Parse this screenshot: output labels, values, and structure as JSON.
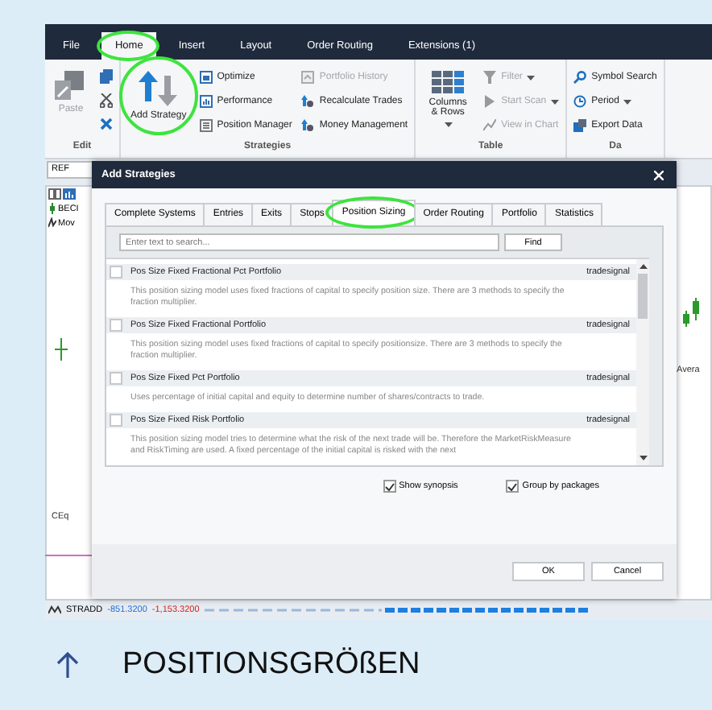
{
  "ribbon": {
    "tabs": [
      {
        "label": "File",
        "selected": false,
        "highlighted": false
      },
      {
        "label": "Home",
        "selected": true,
        "highlighted": true
      },
      {
        "label": "Insert",
        "selected": false,
        "highlighted": false
      },
      {
        "label": "Layout",
        "selected": false,
        "highlighted": false
      },
      {
        "label": "Order Routing",
        "selected": false,
        "highlighted": false
      },
      {
        "label": "Extensions (1)",
        "selected": false,
        "highlighted": false
      }
    ],
    "groups": [
      {
        "label": "Edit",
        "items": [
          {
            "label": "Paste",
            "kind": "large",
            "disabled": true,
            "dropdown": false,
            "highlighted": false
          }
        ]
      },
      {
        "label": "Strategies",
        "items": [
          {
            "label": "Add Strategy",
            "kind": "large",
            "disabled": false,
            "dropdown": false,
            "highlighted": true
          },
          {
            "label": "Optimize",
            "kind": "small",
            "disabled": false,
            "dropdown": false,
            "highlighted": false
          },
          {
            "label": "Performance",
            "kind": "small",
            "disabled": false,
            "dropdown": false,
            "highlighted": false
          },
          {
            "label": "Position Manager",
            "kind": "small",
            "disabled": false,
            "dropdown": false,
            "highlighted": false
          },
          {
            "label": "Portfolio History",
            "kind": "small",
            "disabled": true,
            "dropdown": false,
            "highlighted": false
          },
          {
            "label": "Recalculate Trades",
            "kind": "small",
            "disabled": false,
            "dropdown": false,
            "highlighted": false
          },
          {
            "label": "Money Management",
            "kind": "small",
            "disabled": false,
            "dropdown": false,
            "highlighted": false
          }
        ]
      },
      {
        "label": "Table",
        "items": [
          {
            "label": "Columns & Rows",
            "kind": "large",
            "disabled": false,
            "dropdown": true,
            "highlighted": false
          },
          {
            "label": "Filter",
            "kind": "small",
            "disabled": true,
            "dropdown": true,
            "highlighted": false
          },
          {
            "label": "Start Scan",
            "kind": "small",
            "disabled": true,
            "dropdown": true,
            "highlighted": false
          },
          {
            "label": "View in Chart",
            "kind": "small",
            "disabled": true,
            "dropdown": false,
            "highlighted": false
          }
        ]
      },
      {
        "label": "Da",
        "items": [
          {
            "label": "Symbol Search",
            "kind": "small",
            "disabled": false,
            "dropdown": false,
            "highlighted": false
          },
          {
            "label": "Period",
            "kind": "small",
            "disabled": false,
            "dropdown": true,
            "highlighted": false
          },
          {
            "label": "Export Data",
            "kind": "small",
            "disabled": false,
            "dropdown": false,
            "highlighted": false
          }
        ]
      }
    ]
  },
  "workspace": {
    "symbol_field": "REF",
    "left_items": [
      "BECI",
      "Mov"
    ],
    "chart_label": "CEq",
    "right_label": "Avera",
    "status": {
      "name": "STRADD",
      "value_1": "-851.3200",
      "value_2": "-1,153.3200"
    }
  },
  "dialog": {
    "title": "Add Strategies",
    "tabs": [
      {
        "label": "Complete Systems",
        "selected": false,
        "highlighted": false
      },
      {
        "label": "Entries",
        "selected": false,
        "highlighted": false
      },
      {
        "label": "Exits",
        "selected": false,
        "highlighted": false
      },
      {
        "label": "Stops",
        "selected": false,
        "highlighted": false
      },
      {
        "label": "Position Sizing",
        "selected": true,
        "highlighted": true
      },
      {
        "label": "Order Routing",
        "selected": false,
        "highlighted": false
      },
      {
        "label": "Portfolio",
        "selected": false,
        "highlighted": false
      },
      {
        "label": "Statistics",
        "selected": false,
        "highlighted": false
      }
    ],
    "search": {
      "placeholder": "Enter text to search...",
      "button": "Find"
    },
    "items": [
      {
        "name": "Pos Size Fixed Fractional Pct Portfolio",
        "vendor": "tradesignal",
        "checked": false,
        "description": "This position sizing model uses fixed fractions of capital to specify position size. There are 3 methods to specify the fraction multiplier."
      },
      {
        "name": "Pos Size Fixed Fractional Portfolio",
        "vendor": "tradesignal",
        "checked": false,
        "description": "This position sizing model uses fixed fractions of capital to specify positionsize. There are 3 methods to specify the fraction multiplier."
      },
      {
        "name": "Pos Size Fixed Pct Portfolio",
        "vendor": "tradesignal",
        "checked": false,
        "description": "Uses percentage of initial capital and equity to determine number of shares/contracts to trade."
      },
      {
        "name": "Pos Size Fixed Risk Portfolio",
        "vendor": "tradesignal",
        "checked": false,
        "description": "This position sizing model tries to determine what the risk of the next trade will be. Therefore the MarketRiskMeasure and RiskTiming are used. A fixed percentage of the initial capital is risked with the next"
      }
    ],
    "options": [
      {
        "label": "Show synopsis",
        "checked": true
      },
      {
        "label": "Group by packages",
        "checked": true
      }
    ],
    "buttons": [
      "OK",
      "Cancel"
    ]
  },
  "caption": {
    "text": "POSITIONSGRÖßEN"
  }
}
